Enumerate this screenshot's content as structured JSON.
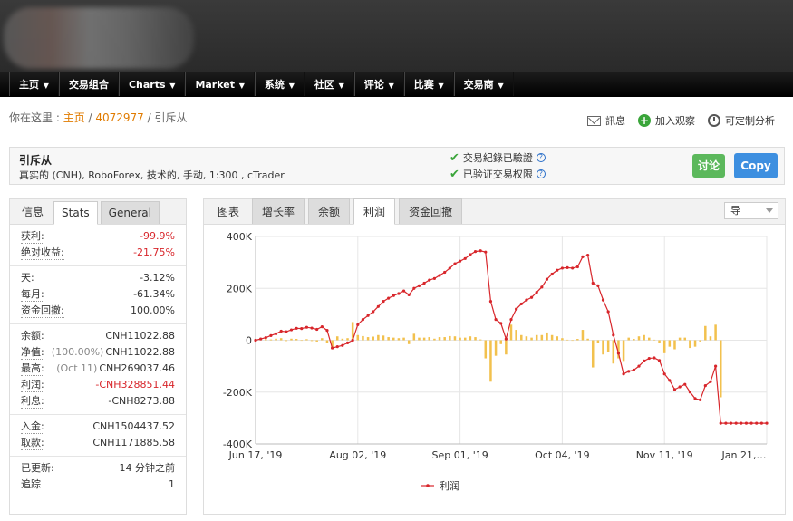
{
  "nav": [
    "主页",
    "交易组合",
    "Charts",
    "Market",
    "系统",
    "社区",
    "评论",
    "比赛",
    "交易商"
  ],
  "nav_has_caret": [
    true,
    false,
    true,
    true,
    true,
    true,
    true,
    true,
    true
  ],
  "breadcrumb": {
    "prefix": "你在这里 : ",
    "home": "主页",
    "sep1": " / ",
    "account": "4072977",
    "sep2": " / ",
    "current": "引斥从"
  },
  "actions": {
    "messages": "訊息",
    "watch": "加入观察",
    "analysis": "可定制分析"
  },
  "account": {
    "name": "引斥从",
    "description": "真实的 (CNH), RoboForex, 技术的, 手动, 1:300 , cTrader",
    "verified_records": "交易紀錄已驗證",
    "verified_privileges": "已验证交易权限",
    "discuss_button": "讨论",
    "copy_button": "Copy"
  },
  "left_tabs": [
    "信息",
    "Stats",
    "General"
  ],
  "stats_groups": [
    [
      {
        "k": "获利:",
        "v": "-99.9%",
        "red": true
      },
      {
        "k": "绝对收益:",
        "v": "-21.75%",
        "red": true
      }
    ],
    [
      {
        "k": "天:",
        "v": "-3.12%"
      },
      {
        "k": "每月:",
        "v": "-61.34%"
      },
      {
        "k": "资金回撤:",
        "v": "100.00%"
      }
    ],
    [
      {
        "k": "余额:",
        "v": "CNH11022.88"
      },
      {
        "k": "净值:",
        "pre": "(100.00%)",
        "v": "CNH11022.88"
      },
      {
        "k": "最高:",
        "pre": "(Oct 11)",
        "v": "CNH269037.46"
      },
      {
        "k": "利润:",
        "v": "-CNH328851.44",
        "red": true
      },
      {
        "k": "利息:",
        "v": "-CNH8273.88"
      }
    ],
    [
      {
        "k": "入金:",
        "v": "CNH1504437.52"
      },
      {
        "k": "取款:",
        "v": "CNH1171885.58"
      }
    ],
    [
      {
        "k": "已更新:",
        "v": "14 分钟之前",
        "plain": true
      },
      {
        "k": "追踪",
        "v": "1",
        "plain": true
      }
    ]
  ],
  "chart_tabs": [
    "图表",
    "增长率",
    "余额",
    "利润",
    "资金回撤"
  ],
  "chart_tab_active": 3,
  "chart_select": "导",
  "colors": {
    "line": "#d8262b",
    "bars": "#f2c14e",
    "accent_orange": "#e07b00",
    "green": "#5cb85c",
    "blue": "#3d8fe0"
  },
  "chart_data": {
    "type": "line",
    "y_ticks": [
      "400K",
      "200K",
      "0",
      "-200K",
      "-400K"
    ],
    "y_values": [
      400000,
      200000,
      0,
      -200000,
      -400000
    ],
    "ylim": [
      -400000,
      400000
    ],
    "x_ticks": [
      "Jun 17, '19",
      "Aug 02, '19",
      "Sep 01, '19",
      "Oct 04, '19",
      "Nov 11, '19",
      "Jan 21,…"
    ],
    "x_tick_pos": [
      0,
      0.2,
      0.4,
      0.6,
      0.8,
      1.0
    ],
    "legend": [
      "利润"
    ],
    "series": [
      {
        "name": "利润",
        "x": [
          0,
          0.01,
          0.02,
          0.03,
          0.04,
          0.05,
          0.06,
          0.07,
          0.08,
          0.09,
          0.1,
          0.11,
          0.12,
          0.13,
          0.14,
          0.15,
          0.16,
          0.17,
          0.18,
          0.19,
          0.2,
          0.21,
          0.22,
          0.23,
          0.24,
          0.25,
          0.26,
          0.27,
          0.28,
          0.29,
          0.3,
          0.31,
          0.32,
          0.33,
          0.34,
          0.35,
          0.36,
          0.37,
          0.38,
          0.39,
          0.4,
          0.41,
          0.42,
          0.43,
          0.44,
          0.45,
          0.46,
          0.47,
          0.48,
          0.49,
          0.5,
          0.51,
          0.52,
          0.53,
          0.54,
          0.55,
          0.56,
          0.57,
          0.58,
          0.59,
          0.6,
          0.61,
          0.62,
          0.63,
          0.64,
          0.65,
          0.66,
          0.67,
          0.68,
          0.69,
          0.7,
          0.71,
          0.72,
          0.73,
          0.74,
          0.75,
          0.76,
          0.77,
          0.78,
          0.79,
          0.8,
          0.81,
          0.82,
          0.83,
          0.84,
          0.85,
          0.86,
          0.87,
          0.88,
          0.89,
          0.9,
          0.91,
          0.92,
          0.93,
          0.94,
          0.95,
          0.96,
          0.97,
          0.98,
          0.99,
          1.0
        ],
        "values": [
          0,
          5000,
          10000,
          18000,
          25000,
          35000,
          33000,
          40000,
          46000,
          45000,
          50000,
          47000,
          42000,
          52000,
          38000,
          -30000,
          -25000,
          -20000,
          -10000,
          0,
          60000,
          80000,
          95000,
          110000,
          130000,
          150000,
          162000,
          172000,
          180000,
          190000,
          175000,
          200000,
          210000,
          220000,
          232000,
          238000,
          250000,
          262000,
          278000,
          295000,
          305000,
          315000,
          330000,
          342000,
          345000,
          340000,
          150000,
          80000,
          65000,
          5000,
          80000,
          120000,
          140000,
          155000,
          165000,
          185000,
          205000,
          235000,
          255000,
          270000,
          278000,
          280000,
          278000,
          283000,
          322000,
          328000,
          220000,
          210000,
          155000,
          110000,
          20000,
          -50000,
          -130000,
          -120000,
          -115000,
          -100000,
          -80000,
          -70000,
          -68000,
          -78000,
          -130000,
          -155000,
          -190000,
          -180000,
          -170000,
          -200000,
          -225000,
          -230000,
          -175000,
          -160000,
          -100000,
          -320000,
          -320000,
          -320000,
          -320000,
          -320000,
          -320000,
          -320000,
          -320000,
          -320000,
          -320000
        ]
      }
    ],
    "bars": {
      "name": "daily",
      "values": [
        0,
        3000,
        4000,
        3000,
        6000,
        8000,
        -3000,
        6000,
        5000,
        -2000,
        4000,
        -3000,
        -5000,
        8000,
        -12000,
        -30000,
        15000,
        6000,
        8000,
        70000,
        20000,
        16000,
        12000,
        14000,
        20000,
        18000,
        12000,
        10000,
        8000,
        10000,
        -15000,
        25000,
        10000,
        10000,
        12000,
        6000,
        12000,
        12000,
        16000,
        15000,
        10000,
        10000,
        15000,
        12000,
        3000,
        -70000,
        -160000,
        -60000,
        -15000,
        -55000,
        60000,
        40000,
        20000,
        15000,
        10000,
        20000,
        20000,
        30000,
        20000,
        15000,
        8000,
        2000,
        -2000,
        5000,
        40000,
        6000,
        -105000,
        -10000,
        -55000,
        -45000,
        -90000,
        -70000,
        -80000,
        10000,
        5000,
        15000,
        20000,
        10000,
        2000,
        -10000,
        -50000,
        -25000,
        -35000,
        10000,
        10000,
        -30000,
        -25000,
        -5000,
        55000,
        15000,
        60000,
        -220000,
        0,
        0,
        0,
        0,
        0,
        0,
        0,
        0,
        0
      ]
    }
  }
}
